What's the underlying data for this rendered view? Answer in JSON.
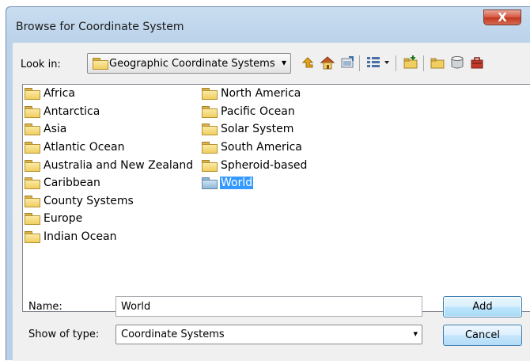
{
  "window": {
    "title": "Browse for Coordinate System",
    "close_glyph": "X"
  },
  "lookin": {
    "label": "Look in:",
    "value": "Geographic Coordinate Systems",
    "arrow": "▾"
  },
  "toolbar": {
    "icons": [
      "up-folder-icon",
      "home-icon",
      "connect-folder-icon",
      "view-menu-icon",
      "new-folder-icon",
      "folder-icon",
      "database-icon",
      "toolbox-icon"
    ]
  },
  "files": {
    "column1": [
      "Africa",
      "Antarctica",
      "Asia",
      "Atlantic Ocean",
      "Australia and New Zealand",
      "Caribbean",
      "County Systems",
      "Europe",
      "Indian Ocean"
    ],
    "column2": [
      "North America",
      "Pacific Ocean",
      "Solar System",
      "South America",
      "Spheroid-based",
      "World"
    ],
    "selected": "World"
  },
  "name": {
    "label": "Name:",
    "value": "World"
  },
  "type": {
    "label": "Show of type:",
    "value": "Coordinate Systems",
    "arrow": "▾"
  },
  "buttons": {
    "add": "Add",
    "cancel": "Cancel"
  },
  "colors": {
    "selection": "#3399ff",
    "title_bar": "#bcd3ea",
    "close_button": "#c1361d"
  }
}
